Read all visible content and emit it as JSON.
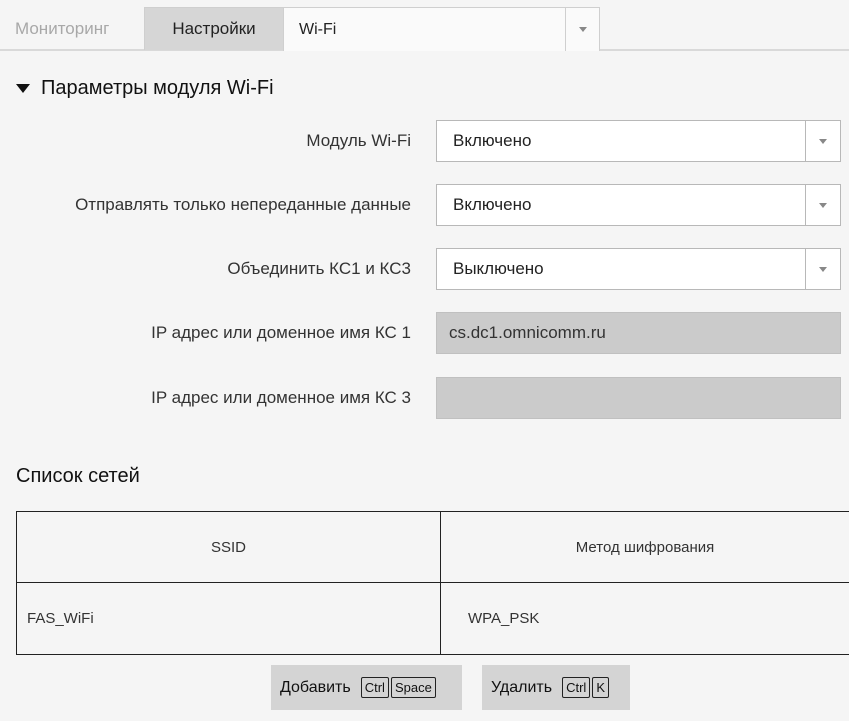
{
  "tabs": {
    "monitoring": "Мониторинг",
    "settings": "Настройки",
    "selected_page": "Wi-Fi"
  },
  "section": {
    "title": "Параметры модуля Wi-Fi"
  },
  "fields": [
    {
      "label": "Модуль Wi-Fi",
      "value": "Включено"
    },
    {
      "label": "Отправлять только непереданные данные",
      "value": "Включено"
    },
    {
      "label": "Объединить КС1 и КС3",
      "value": "Выключено"
    },
    {
      "label": "IP адрес или доменное имя КС 1",
      "value": "cs.dc1.omnicomm.ru"
    },
    {
      "label": "IP адрес или доменное имя КС 3",
      "value": ""
    }
  ],
  "networks": {
    "title": "Список сетей",
    "columns": [
      "SSID",
      "Метод шифрования"
    ],
    "rows": [
      {
        "ssid": "FAS_WiFi",
        "encryption": "WPA_PSK"
      }
    ]
  },
  "buttons": {
    "add": {
      "label": "Добавить",
      "keys": [
        "Ctrl",
        "Space"
      ]
    },
    "delete": {
      "label": "Удалить",
      "keys": [
        "Ctrl",
        "K"
      ]
    }
  },
  "icons": {
    "dropdown": "chevron-down-icon",
    "collapse": "caret-down-icon"
  }
}
